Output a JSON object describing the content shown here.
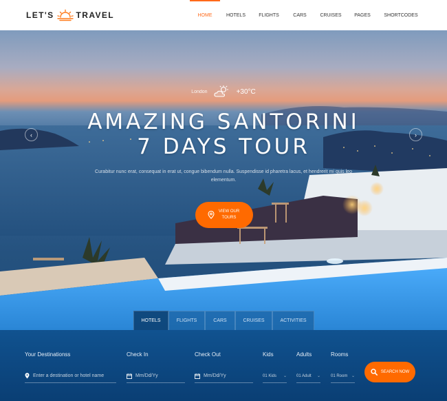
{
  "header": {
    "logo": {
      "left": "LET'S",
      "right": "TRAVEL"
    },
    "nav": [
      {
        "label": "HOME",
        "active": true
      },
      {
        "label": "HOTELS"
      },
      {
        "label": "FLIGHTS"
      },
      {
        "label": "CARS"
      },
      {
        "label": "CRUISES"
      },
      {
        "label": "PAGES"
      },
      {
        "label": "SHORTCODES"
      }
    ]
  },
  "hero": {
    "weather": {
      "city": "London",
      "temperature": "+30°C",
      "icon": "partly-cloudy-icon"
    },
    "title_line1": "AMAZING SANTORINI",
    "title_line2": "7 DAYS TOUR",
    "subtitle": "Curabitur nunc erat, consequat in erat ut, congue bibendum nulla. Suspendisse id pharetra lacus, et hendrerit mi quis leo elementum.",
    "cta_label": "VIEW OUR TOURS",
    "prev_icon": "chevron-left-icon",
    "next_icon": "chevron-right-icon"
  },
  "search": {
    "tabs": [
      {
        "label": "HOTELS",
        "active": true
      },
      {
        "label": "FLIGHTS"
      },
      {
        "label": "CARS"
      },
      {
        "label": "CRUISES"
      },
      {
        "label": "ACTIVITIES"
      }
    ],
    "destination": {
      "label": "Your Destinationss",
      "placeholder": "Enter a destination or hotel name"
    },
    "check_in": {
      "label": "Check In",
      "placeholder": "Mm/Dd/Yy"
    },
    "check_out": {
      "label": "Check Out",
      "placeholder": "Mm/Dd/Yy"
    },
    "kids": {
      "label": "Kids",
      "value": "01 Kids"
    },
    "adults": {
      "label": "Adults",
      "value": "01 Adult"
    },
    "rooms": {
      "label": "Rooms",
      "value": "01 Room"
    },
    "button_label": "SEARCH NOW"
  },
  "colors": {
    "accent": "#ff6a00",
    "panel": "#0e4e8a",
    "header_bg": "#ffffff"
  }
}
